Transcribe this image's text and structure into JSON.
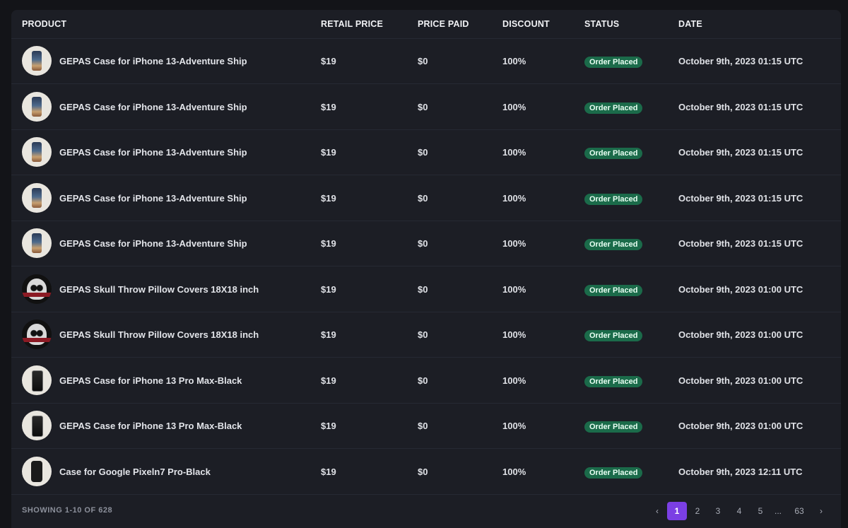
{
  "table": {
    "columns": {
      "product": "PRODUCT",
      "retail_price": "RETAIL PRICE",
      "price_paid": "PRICE PAID",
      "discount": "DISCOUNT",
      "status": "STATUS",
      "date": "DATE"
    },
    "rows": [
      {
        "thumb": "phone-case-ship",
        "product": "GEPAS Case for iPhone 13-Adventure Ship",
        "retail": "$19",
        "paid": "$0",
        "discount": "100%",
        "status": "Order Placed",
        "date": "October 9th, 2023 01:15 UTC"
      },
      {
        "thumb": "phone-case-ship",
        "product": "GEPAS Case for iPhone 13-Adventure Ship",
        "retail": "$19",
        "paid": "$0",
        "discount": "100%",
        "status": "Order Placed",
        "date": "October 9th, 2023 01:15 UTC"
      },
      {
        "thumb": "phone-case-ship",
        "product": "GEPAS Case for iPhone 13-Adventure Ship",
        "retail": "$19",
        "paid": "$0",
        "discount": "100%",
        "status": "Order Placed",
        "date": "October 9th, 2023 01:15 UTC"
      },
      {
        "thumb": "phone-case-ship",
        "product": "GEPAS Case for iPhone 13-Adventure Ship",
        "retail": "$19",
        "paid": "$0",
        "discount": "100%",
        "status": "Order Placed",
        "date": "October 9th, 2023 01:15 UTC"
      },
      {
        "thumb": "phone-case-ship",
        "product": "GEPAS Case for iPhone 13-Adventure Ship",
        "retail": "$19",
        "paid": "$0",
        "discount": "100%",
        "status": "Order Placed",
        "date": "October 9th, 2023 01:15 UTC"
      },
      {
        "thumb": "skull-pillow",
        "product": "GEPAS Skull Throw Pillow Covers 18X18 inch",
        "retail": "$19",
        "paid": "$0",
        "discount": "100%",
        "status": "Order Placed",
        "date": "October 9th, 2023 01:00 UTC"
      },
      {
        "thumb": "skull-pillow",
        "product": "GEPAS Skull Throw Pillow Covers 18X18 inch",
        "retail": "$19",
        "paid": "$0",
        "discount": "100%",
        "status": "Order Placed",
        "date": "October 9th, 2023 01:00 UTC"
      },
      {
        "thumb": "phone-case-black",
        "product": "GEPAS Case for iPhone 13 Pro Max-Black",
        "retail": "$19",
        "paid": "$0",
        "discount": "100%",
        "status": "Order Placed",
        "date": "October 9th, 2023 01:00 UTC"
      },
      {
        "thumb": "phone-case-black",
        "product": "GEPAS Case for iPhone 13 Pro Max-Black",
        "retail": "$19",
        "paid": "$0",
        "discount": "100%",
        "status": "Order Placed",
        "date": "October 9th, 2023 01:00 UTC"
      },
      {
        "thumb": "pixel-case",
        "product": "Case for Google Pixeln7 Pro-Black",
        "retail": "$19",
        "paid": "$0",
        "discount": "100%",
        "status": "Order Placed",
        "date": "October 9th, 2023 12:11 UTC"
      }
    ]
  },
  "footer": {
    "showing": "SHOWING 1-10 OF 628",
    "pagination": {
      "prev": "‹",
      "pages": [
        "1",
        "2",
        "3",
        "4",
        "5",
        "...",
        "63"
      ],
      "active": "1",
      "next": "›"
    }
  },
  "colors": {
    "background": "#131418",
    "panel": "#1c1e25",
    "status_badge": "#1b6b4a",
    "accent": "#7b3fe4"
  }
}
